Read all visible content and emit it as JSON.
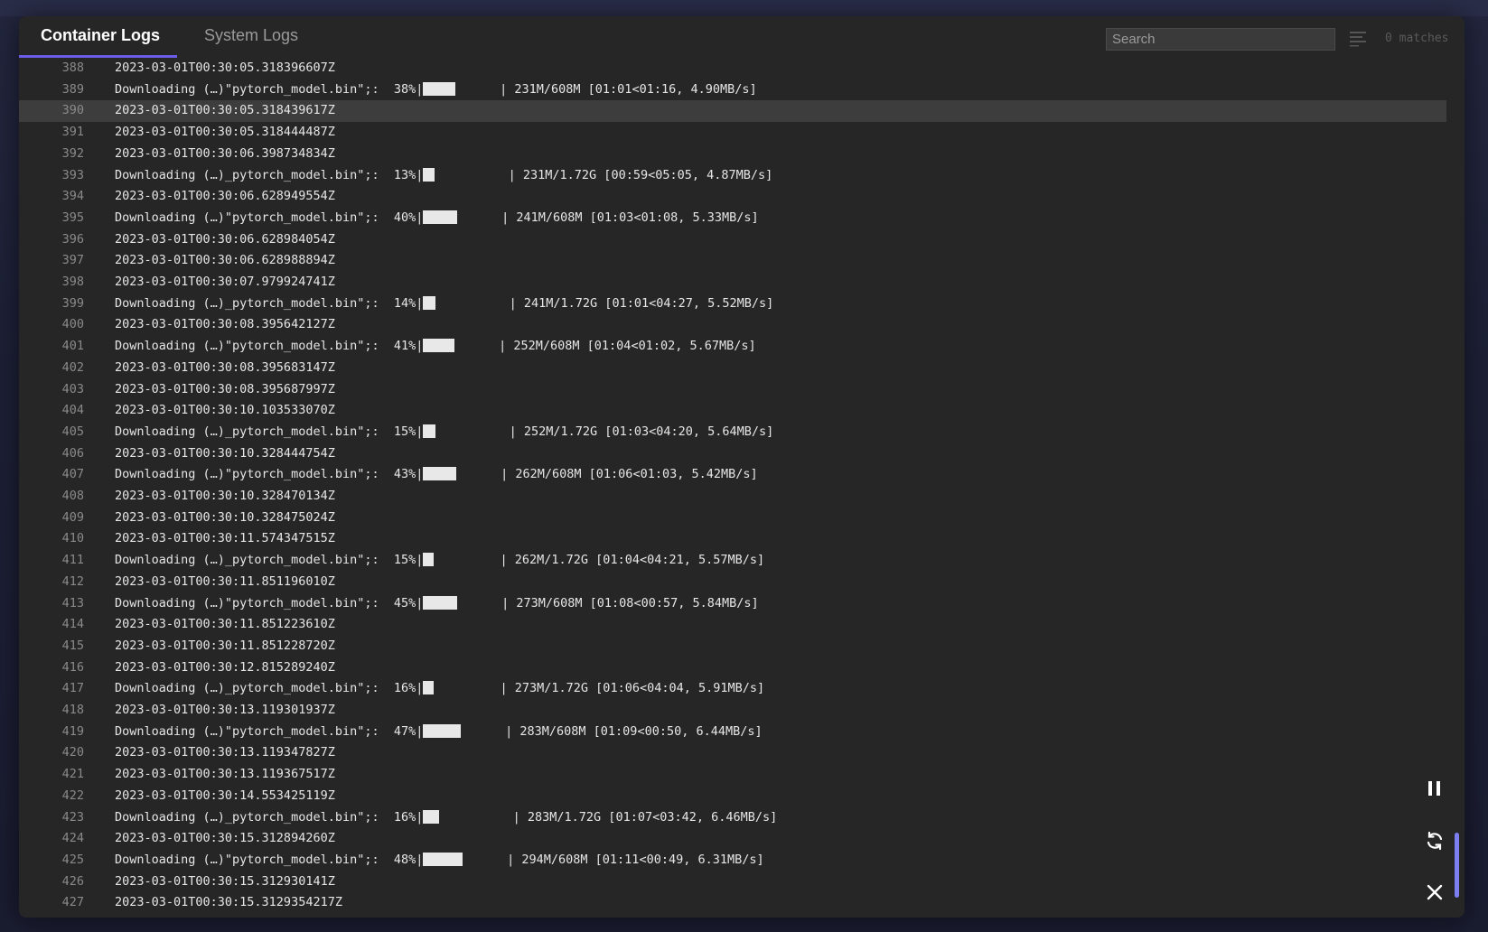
{
  "tabs": [
    {
      "label": "Container Logs",
      "active": true
    },
    {
      "label": "System Logs",
      "active": false
    }
  ],
  "search": {
    "placeholder": "Search",
    "value": ""
  },
  "matches_label": "0 matches",
  "icons": {
    "filter": "lines-filter-icon",
    "pause": "pause-icon",
    "refresh": "refresh-icon",
    "close": "close-icon"
  },
  "colors": {
    "accent": "#6c5ce7",
    "scrollbar": "#7b7ff0",
    "highlight_row": "#3d3d3d"
  },
  "highlighted_line": 390,
  "lines": [
    {
      "n": "388",
      "t": "2023-03-01T00:30:05.318396607Z"
    },
    {
      "n": "389",
      "t": "Downloading (…)\"pytorch_model.bin\";:  38%|",
      "p": 0.38,
      "w": 36,
      "s": "      | 231M/608M [01:01<01:16, 4.90MB/s]"
    },
    {
      "n": "390",
      "t": "2023-03-01T00:30:05.318439617Z"
    },
    {
      "n": "391",
      "t": "2023-03-01T00:30:05.318444487Z"
    },
    {
      "n": "392",
      "t": "2023-03-01T00:30:06.398734834Z"
    },
    {
      "n": "393",
      "t": "Downloading (…)_pytorch_model.bin\";:  13%|",
      "p": 0.13,
      "w": 13,
      "s": "          | 231M/1.72G [00:59<05:05, 4.87MB/s]"
    },
    {
      "n": "394",
      "t": "2023-03-01T00:30:06.628949554Z"
    },
    {
      "n": "395",
      "t": "Downloading (…)\"pytorch_model.bin\";:  40%|",
      "p": 0.4,
      "w": 38,
      "s": "      | 241M/608M [01:03<01:08, 5.33MB/s]"
    },
    {
      "n": "396",
      "t": "2023-03-01T00:30:06.628984054Z"
    },
    {
      "n": "397",
      "t": "2023-03-01T00:30:06.628988894Z"
    },
    {
      "n": "398",
      "t": "2023-03-01T00:30:07.979924741Z"
    },
    {
      "n": "399",
      "t": "Downloading (…)_pytorch_model.bin\";:  14%|",
      "p": 0.14,
      "w": 14,
      "s": "          | 241M/1.72G [01:01<04:27, 5.52MB/s]"
    },
    {
      "n": "400",
      "t": "2023-03-01T00:30:08.395642127Z"
    },
    {
      "n": "401",
      "t": "Downloading (…)\"pytorch_model.bin\";:  41%|",
      "p": 0.41,
      "w": 35,
      "s": "      | 252M/608M [01:04<01:02, 5.67MB/s]"
    },
    {
      "n": "402",
      "t": "2023-03-01T00:30:08.395683147Z"
    },
    {
      "n": "403",
      "t": "2023-03-01T00:30:08.395687997Z"
    },
    {
      "n": "404",
      "t": "2023-03-01T00:30:10.103533070Z"
    },
    {
      "n": "405",
      "t": "Downloading (…)_pytorch_model.bin\";:  15%|",
      "p": 0.15,
      "w": 14,
      "s": "          | 252M/1.72G [01:03<04:20, 5.64MB/s]"
    },
    {
      "n": "406",
      "t": "2023-03-01T00:30:10.328444754Z"
    },
    {
      "n": "407",
      "t": "Downloading (…)\"pytorch_model.bin\";:  43%|",
      "p": 0.43,
      "w": 37,
      "s": "      | 262M/608M [01:06<01:03, 5.42MB/s]"
    },
    {
      "n": "408",
      "t": "2023-03-01T00:30:10.328470134Z"
    },
    {
      "n": "409",
      "t": "2023-03-01T00:30:10.328475024Z"
    },
    {
      "n": "410",
      "t": "2023-03-01T00:30:11.574347515Z"
    },
    {
      "n": "411",
      "t": "Downloading (…)_pytorch_model.bin\";:  15%|",
      "p": 0.15,
      "w": 12,
      "s": "         | 262M/1.72G [01:04<04:21, 5.57MB/s]"
    },
    {
      "n": "412",
      "t": "2023-03-01T00:30:11.851196010Z"
    },
    {
      "n": "413",
      "t": "Downloading (…)\"pytorch_model.bin\";:  45%|",
      "p": 0.45,
      "w": 38,
      "s": "      | 273M/608M [01:08<00:57, 5.84MB/s]"
    },
    {
      "n": "414",
      "t": "2023-03-01T00:30:11.851223610Z"
    },
    {
      "n": "415",
      "t": "2023-03-01T00:30:11.851228720Z"
    },
    {
      "n": "416",
      "t": "2023-03-01T00:30:12.815289240Z"
    },
    {
      "n": "417",
      "t": "Downloading (…)_pytorch_model.bin\";:  16%|",
      "p": 0.16,
      "w": 12,
      "s": "         | 273M/1.72G [01:06<04:04, 5.91MB/s]"
    },
    {
      "n": "418",
      "t": "2023-03-01T00:30:13.119301937Z"
    },
    {
      "n": "419",
      "t": "Downloading (…)\"pytorch_model.bin\";:  47%|",
      "p": 0.47,
      "w": 42,
      "s": "      | 283M/608M [01:09<00:50, 6.44MB/s]"
    },
    {
      "n": "420",
      "t": "2023-03-01T00:30:13.119347827Z"
    },
    {
      "n": "421",
      "t": "2023-03-01T00:30:13.119367517Z"
    },
    {
      "n": "422",
      "t": "2023-03-01T00:30:14.553425119Z"
    },
    {
      "n": "423",
      "t": "Downloading (…)_pytorch_model.bin\";:  16%|",
      "p": 0.16,
      "w": 18,
      "s": "          | 283M/1.72G [01:07<03:42, 6.46MB/s]"
    },
    {
      "n": "424",
      "t": "2023-03-01T00:30:15.312894260Z"
    },
    {
      "n": "425",
      "t": "Downloading (…)\"pytorch_model.bin\";:  48%|",
      "p": 0.48,
      "w": 44,
      "s": "      | 294M/608M [01:11<00:49, 6.31MB/s]"
    },
    {
      "n": "426",
      "t": "2023-03-01T00:30:15.312930141Z"
    },
    {
      "n": "427",
      "t": "2023-03-01T00:30:15.3129354217Z"
    }
  ]
}
